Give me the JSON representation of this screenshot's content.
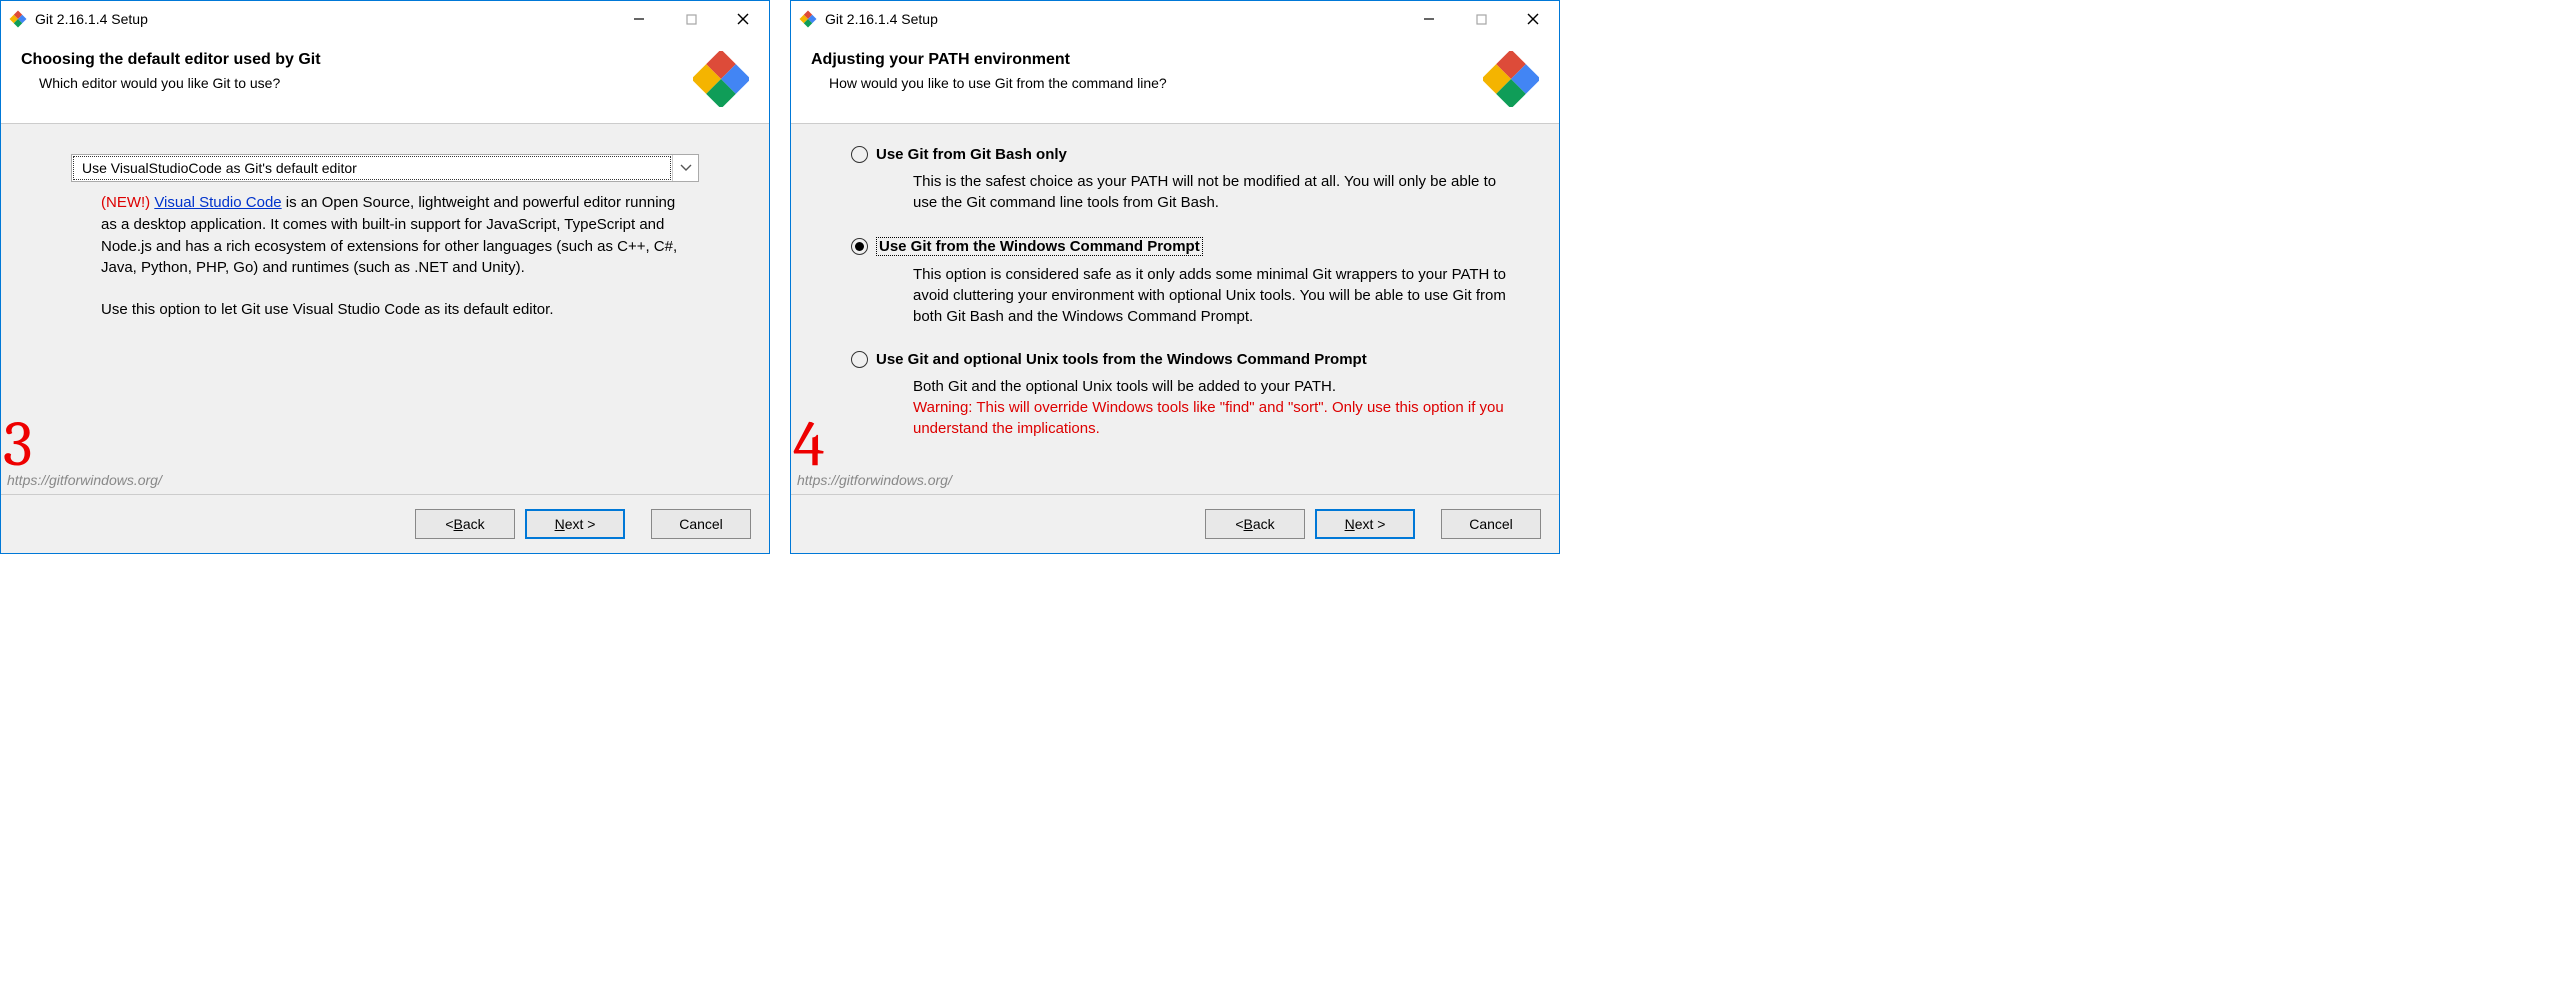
{
  "left": {
    "titlebar": "Git 2.16.1.4 Setup",
    "header_title": "Choosing the default editor used by Git",
    "header_subtitle": "Which editor would you like Git to use?",
    "combo_value": "Use VisualStudioCode as Git's default editor",
    "desc_new": "(NEW!)",
    "desc_link": "Visual Studio Code",
    "desc_main": " is an Open Source, lightweight and powerful editor running as a desktop application. It comes with built-in support for JavaScript, TypeScript and Node.js and has a rich ecosystem of extensions for other languages (such as C++, C#, Java, Python, PHP, Go) and runtimes (such as .NET and Unity).",
    "desc_p2": "Use this option to let Git use Visual Studio Code as its default editor.",
    "footer_url": "https://gitforwindows.org/",
    "step": "3",
    "buttons": {
      "back_pre": "< ",
      "back": "B",
      "back_post": "ack",
      "next": "N",
      "next_post": "ext >",
      "cancel": "Cancel"
    }
  },
  "right": {
    "titlebar": "Git 2.16.1.4 Setup",
    "header_title": "Adjusting your PATH environment",
    "header_subtitle": "How would you like to use Git from the command line?",
    "opt1": {
      "label": "Use Git from Git Bash only",
      "desc": "This is the safest choice as your PATH will not be modified at all. You will only be able to use the Git command line tools from Git Bash."
    },
    "opt2": {
      "label": "Use Git from the Windows Command Prompt",
      "desc": "This option is considered safe as it only adds some minimal Git wrappers to your PATH to avoid cluttering your environment with optional Unix tools. You will be able to use Git from both Git Bash and the Windows Command Prompt."
    },
    "opt3": {
      "label": "Use Git and optional Unix tools from the Windows Command Prompt",
      "desc": "Both Git and the optional Unix tools will be added to your PATH.",
      "warn": "Warning: This will override Windows tools like \"find\" and \"sort\". Only use this option if you understand the implications."
    },
    "footer_url": "https://gitforwindows.org/",
    "step": "4",
    "buttons": {
      "back_pre": "< ",
      "back": "B",
      "back_post": "ack",
      "next": "N",
      "next_post": "ext >",
      "cancel": "Cancel"
    }
  }
}
